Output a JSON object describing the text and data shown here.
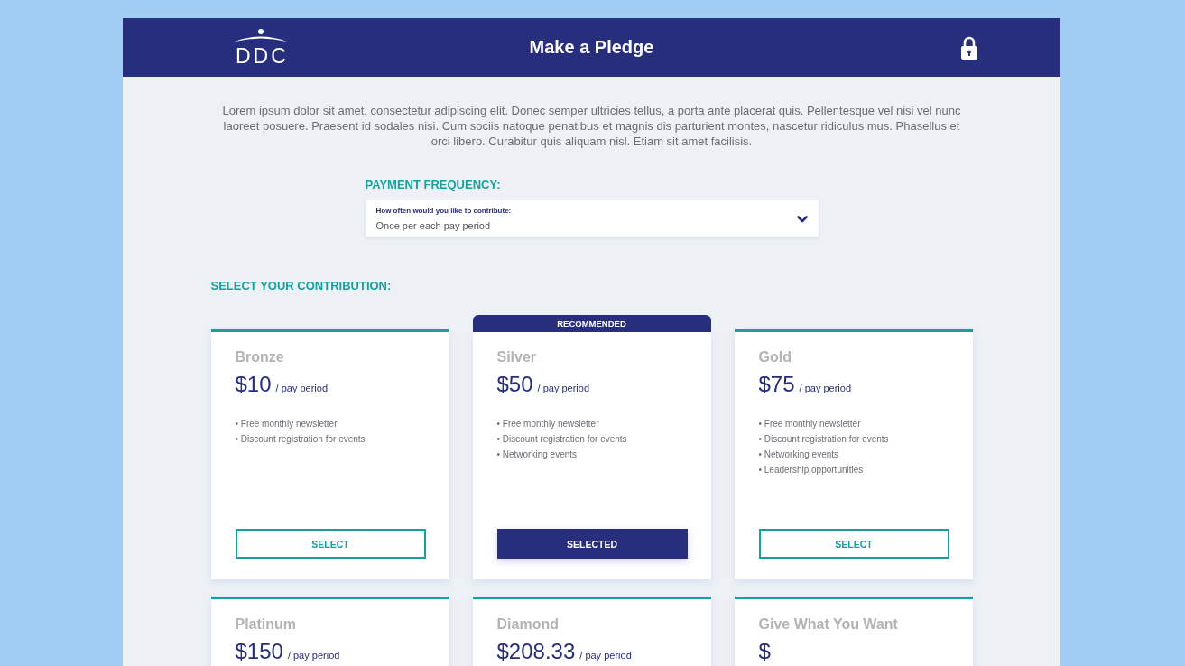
{
  "header": {
    "logo": "DDC",
    "title": "Make a Pledge"
  },
  "intro": "Lorem ipsum dolor sit amet, consectetur adipiscing elit. Donec semper ultricies tellus, a porta ante placerat quis. Pellentesque vel nisi vel nunc laoreet posuere. Praesent id sodales nisi. Cum sociis natoque penatibus et magnis dis parturient montes, nascetur ridiculus mus. Phasellus et orci libero. Curabitur quis aliquam nisl. Etiam sit amet facilisis.",
  "payment_frequency": {
    "heading": "PAYMENT FREQUENCY:",
    "dropdown": {
      "label": "How often would you like to contribute:",
      "value": "Once per each pay period"
    }
  },
  "contribution": {
    "heading": "SELECT YOUR CONTRIBUTION:",
    "tiers": [
      {
        "name": "Bronze",
        "price": "$10",
        "period": "/ pay period",
        "features": [
          "• Free monthly newsletter",
          "• Discount registration for events"
        ],
        "button": "SELECT",
        "selected": false
      },
      {
        "name": "Silver",
        "badge": "RECOMMENDED",
        "price": "$50",
        "period": "/ pay period",
        "features": [
          "• Free monthly newsletter",
          "• Discount registration for events",
          "• Networking events"
        ],
        "button": "SELECTED",
        "selected": true
      },
      {
        "name": "Gold",
        "price": "$75",
        "period": "/ pay period",
        "features": [
          "• Free monthly newsletter",
          "• Discount registration for events",
          "• Networking events",
          "• Leadership opportunities"
        ],
        "button": "SELECT",
        "selected": false
      },
      {
        "name": "Platinum",
        "price": "$150",
        "period": "/ pay period"
      },
      {
        "name": "Diamond",
        "price": "$208.33",
        "period": "/ pay period"
      },
      {
        "name": "Give What You Want",
        "price": "$"
      }
    ]
  }
}
